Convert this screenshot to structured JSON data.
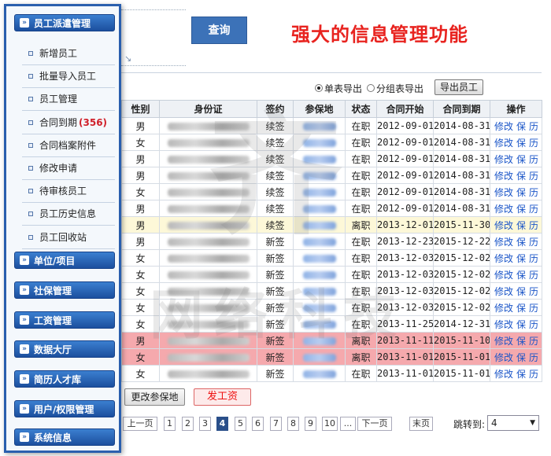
{
  "sidebar": {
    "sections": [
      {
        "label": "员工派遣管理"
      },
      {
        "label": "单位/项目"
      },
      {
        "label": "社保管理"
      },
      {
        "label": "工资管理"
      },
      {
        "label": "数据大厅"
      },
      {
        "label": "简历人才库"
      },
      {
        "label": "用户/权限管理"
      },
      {
        "label": "系统信息"
      }
    ],
    "items": [
      {
        "label": "新增员工"
      },
      {
        "label": "批量导入员工"
      },
      {
        "label": "员工管理"
      },
      {
        "label": "合同到期",
        "count": "(356)"
      },
      {
        "label": "合同档案附件"
      },
      {
        "label": "修改申请"
      },
      {
        "label": "待审核员工"
      },
      {
        "label": "员工历史信息"
      },
      {
        "label": "员工回收站"
      }
    ]
  },
  "header": {
    "query_label": "查询",
    "promo_text": "强大的信息管理功能"
  },
  "export": {
    "single_label": "单表导出",
    "grouped_label": "分组表导出",
    "button_label": "导出员工"
  },
  "table": {
    "columns": [
      "性别",
      "身份证",
      "签约",
      "参保地",
      "状态",
      "合同开始",
      "合同到期",
      "操作"
    ],
    "ops": [
      "修改",
      "保",
      "历"
    ],
    "rows": [
      {
        "gender": "男",
        "sign": "续签",
        "status": "在职",
        "start": "2012-09-01",
        "end": "2014-08-31",
        "hl": ""
      },
      {
        "gender": "女",
        "sign": "续签",
        "status": "在职",
        "start": "2012-09-01",
        "end": "2014-08-31",
        "hl": ""
      },
      {
        "gender": "男",
        "sign": "续签",
        "status": "在职",
        "start": "2012-09-01",
        "end": "2014-08-31",
        "hl": ""
      },
      {
        "gender": "男",
        "sign": "续签",
        "status": "在职",
        "start": "2012-09-01",
        "end": "2014-08-31",
        "hl": ""
      },
      {
        "gender": "女",
        "sign": "续签",
        "status": "在职",
        "start": "2012-09-01",
        "end": "2014-08-31",
        "hl": ""
      },
      {
        "gender": "男",
        "sign": "续签",
        "status": "在职",
        "start": "2012-09-01",
        "end": "2014-08-31",
        "hl": ""
      },
      {
        "gender": "男",
        "sign": "续签",
        "status": "离职",
        "start": "2013-12-01",
        "end": "2015-11-30",
        "hl": "yellow"
      },
      {
        "gender": "男",
        "sign": "新签",
        "status": "在职",
        "start": "2013-12-23",
        "end": "2015-12-22",
        "hl": ""
      },
      {
        "gender": "女",
        "sign": "新签",
        "status": "在职",
        "start": "2013-12-03",
        "end": "2015-12-02",
        "hl": ""
      },
      {
        "gender": "女",
        "sign": "新签",
        "status": "在职",
        "start": "2013-12-03",
        "end": "2015-12-02",
        "hl": ""
      },
      {
        "gender": "女",
        "sign": "新签",
        "status": "在职",
        "start": "2013-12-03",
        "end": "2015-12-02",
        "hl": ""
      },
      {
        "gender": "女",
        "sign": "新签",
        "status": "在职",
        "start": "2013-12-03",
        "end": "2015-12-02",
        "hl": ""
      },
      {
        "gender": "女",
        "sign": "新签",
        "status": "在职",
        "start": "2013-11-25",
        "end": "2014-12-31",
        "hl": ""
      },
      {
        "gender": "男",
        "sign": "新签",
        "status": "离职",
        "start": "2013-11-11",
        "end": "2015-11-10",
        "hl": "red"
      },
      {
        "gender": "女",
        "sign": "新签",
        "status": "离职",
        "start": "2013-11-01",
        "end": "2015-11-01",
        "hl": "red"
      },
      {
        "gender": "女",
        "sign": "新签",
        "status": "在职",
        "start": "2013-11-01",
        "end": "2015-11-01",
        "hl": ""
      }
    ]
  },
  "actions": {
    "change_insurance_label": "更改参保地",
    "payroll_label": "发工资"
  },
  "pagination": {
    "prev_label": "上一页",
    "pages": [
      "1",
      "2",
      "3",
      "4",
      "5",
      "6",
      "7",
      "8",
      "9",
      "10",
      "..."
    ],
    "active_page": "4",
    "next_label": "下一页",
    "last_label": "末页",
    "jump_label": "跳转到:",
    "jump_value": "4"
  },
  "colors": {
    "sidebar_border": "#2a5fae",
    "promo_text": "#e8231f",
    "highlight_yellow": "#fdf8d8",
    "highlight_red": "#f5a9ad",
    "op_link": "#1a55c8"
  }
}
